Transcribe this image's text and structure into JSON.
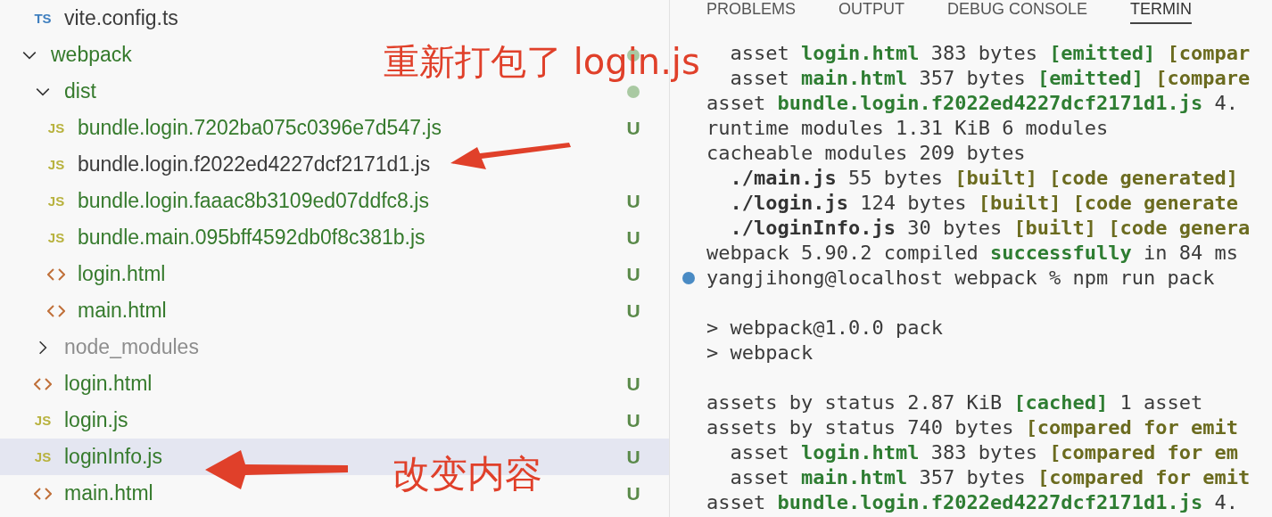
{
  "explorer": {
    "above": [
      {
        "name": "vite.config.ts",
        "kind": "file",
        "badge": "TS",
        "untracked": false,
        "ignored": false
      }
    ],
    "tree": [
      {
        "name": "webpack",
        "kind": "folder",
        "expanded": true,
        "untracked": true,
        "ignored": false,
        "dot": true,
        "children": [
          {
            "name": "dist",
            "kind": "folder",
            "expanded": true,
            "untracked": true,
            "ignored": false,
            "dot": true,
            "children": [
              {
                "name": "bundle.login.7202ba075c0396e7d547.js",
                "kind": "file",
                "badge": "JS",
                "untracked": true,
                "ignored": false,
                "status": "U",
                "selected": false
              },
              {
                "name": "bundle.login.f2022ed4227dcf2171d1.js",
                "kind": "file",
                "badge": "JS",
                "untracked": false,
                "ignored": false,
                "selected": false
              },
              {
                "name": "bundle.login.faaac8b3109ed07ddfc8.js",
                "kind": "file",
                "badge": "JS",
                "untracked": true,
                "ignored": false,
                "status": "U",
                "selected": false
              },
              {
                "name": "bundle.main.095bff4592db0f8c381b.js",
                "kind": "file",
                "badge": "JS",
                "untracked": true,
                "ignored": false,
                "status": "U",
                "selected": false
              },
              {
                "name": "login.html",
                "kind": "html",
                "untracked": true,
                "ignored": false,
                "status": "U",
                "selected": false
              },
              {
                "name": "main.html",
                "kind": "html",
                "untracked": true,
                "ignored": false,
                "status": "U",
                "selected": false
              }
            ]
          },
          {
            "name": "node_modules",
            "kind": "folder",
            "expanded": false,
            "untracked": false,
            "ignored": true
          },
          {
            "name": "login.html",
            "kind": "html",
            "untracked": true,
            "ignored": false,
            "status": "U",
            "selected": false
          },
          {
            "name": "login.js",
            "kind": "file",
            "badge": "JS",
            "untracked": true,
            "ignored": false,
            "status": "U",
            "selected": false
          },
          {
            "name": "loginInfo.js",
            "kind": "file",
            "badge": "JS",
            "untracked": true,
            "ignored": false,
            "status": "U",
            "selected": true
          },
          {
            "name": "main.html",
            "kind": "html",
            "untracked": true,
            "ignored": false,
            "status": "U",
            "selected": false
          }
        ]
      }
    ]
  },
  "panel_tabs": [
    {
      "label": "PROBLEMS",
      "selected": false
    },
    {
      "label": "OUTPUT",
      "selected": false
    },
    {
      "label": "DEBUG CONSOLE",
      "selected": false
    },
    {
      "label": "TERMIN",
      "selected": true
    }
  ],
  "terminal": [
    {
      "kind": "output",
      "segments": [
        {
          "t": "  asset ",
          "kind": "plain"
        },
        {
          "t": "login.html",
          "kind": "green"
        },
        {
          "t": " 383 bytes ",
          "kind": "plain"
        },
        {
          "t": "[emitted]",
          "kind": "green"
        },
        {
          "t": " [compar",
          "kind": "olive"
        }
      ]
    },
    {
      "kind": "output",
      "segments": [
        {
          "t": "  asset ",
          "kind": "plain"
        },
        {
          "t": "main.html",
          "kind": "green"
        },
        {
          "t": " 357 bytes ",
          "kind": "plain"
        },
        {
          "t": "[emitted]",
          "kind": "green"
        },
        {
          "t": " [compare",
          "kind": "olive"
        }
      ]
    },
    {
      "kind": "output",
      "segments": [
        {
          "t": "asset ",
          "kind": "plain"
        },
        {
          "t": "bundle.login.f2022ed4227dcf2171d1.js",
          "kind": "green"
        },
        {
          "t": " 4.",
          "kind": "plain"
        }
      ]
    },
    {
      "kind": "output",
      "segments": [
        {
          "t": "runtime modules 1.31 KiB 6 modules",
          "kind": "plain"
        }
      ]
    },
    {
      "kind": "output",
      "segments": [
        {
          "t": "cacheable modules 209 bytes",
          "kind": "plain"
        }
      ]
    },
    {
      "kind": "output",
      "segments": [
        {
          "t": "  ./main.js",
          "kind": "bold"
        },
        {
          "t": " 55 bytes ",
          "kind": "plain"
        },
        {
          "t": "[built] [code generated]",
          "kind": "olive"
        }
      ]
    },
    {
      "kind": "output",
      "segments": [
        {
          "t": "  ./login.js",
          "kind": "bold"
        },
        {
          "t": " 124 bytes ",
          "kind": "plain"
        },
        {
          "t": "[built] [code generate",
          "kind": "olive"
        }
      ]
    },
    {
      "kind": "output",
      "segments": [
        {
          "t": "  ./loginInfo.js",
          "kind": "bold"
        },
        {
          "t": " 30 bytes ",
          "kind": "plain"
        },
        {
          "t": "[built] [code genera",
          "kind": "olive"
        }
      ]
    },
    {
      "kind": "output",
      "segments": [
        {
          "t": "webpack 5.90.2 compiled ",
          "kind": "plain"
        },
        {
          "t": "successfully",
          "kind": "green"
        },
        {
          "t": " in 84 ms",
          "kind": "plain"
        }
      ]
    },
    {
      "kind": "prompt",
      "segments": [
        {
          "t": "yangjihong@localhost webpack % npm run pack",
          "kind": "plain"
        }
      ]
    },
    {
      "kind": "blank"
    },
    {
      "kind": "output",
      "segments": [
        {
          "t": "> webpack@1.0.0 pack",
          "kind": "plain"
        }
      ]
    },
    {
      "kind": "output",
      "segments": [
        {
          "t": "> webpack",
          "kind": "plain"
        }
      ]
    },
    {
      "kind": "blank"
    },
    {
      "kind": "output",
      "segments": [
        {
          "t": "assets by status 2.87 KiB ",
          "kind": "plain"
        },
        {
          "t": "[cached]",
          "kind": "green"
        },
        {
          "t": " 1 asset",
          "kind": "plain"
        }
      ]
    },
    {
      "kind": "output",
      "segments": [
        {
          "t": "assets by status 740 bytes ",
          "kind": "plain"
        },
        {
          "t": "[compared for emit",
          "kind": "olive"
        }
      ]
    },
    {
      "kind": "output",
      "segments": [
        {
          "t": "  asset ",
          "kind": "plain"
        },
        {
          "t": "login.html",
          "kind": "green"
        },
        {
          "t": " 383 bytes ",
          "kind": "plain"
        },
        {
          "t": "[compared for em",
          "kind": "olive"
        }
      ]
    },
    {
      "kind": "output",
      "segments": [
        {
          "t": "  asset ",
          "kind": "plain"
        },
        {
          "t": "main.html",
          "kind": "green"
        },
        {
          "t": " 357 bytes ",
          "kind": "plain"
        },
        {
          "t": "[compared for emit",
          "kind": "olive"
        }
      ]
    },
    {
      "kind": "output",
      "segments": [
        {
          "t": "asset ",
          "kind": "plain"
        },
        {
          "t": "bundle.login.f2022ed4227dcf2171d1.js",
          "kind": "green"
        },
        {
          "t": " 4.",
          "kind": "plain"
        }
      ]
    }
  ],
  "annotations": [
    {
      "text": "重新打包了 login.js",
      "kind": "top"
    },
    {
      "text": "改变内容",
      "kind": "bottom"
    }
  ]
}
